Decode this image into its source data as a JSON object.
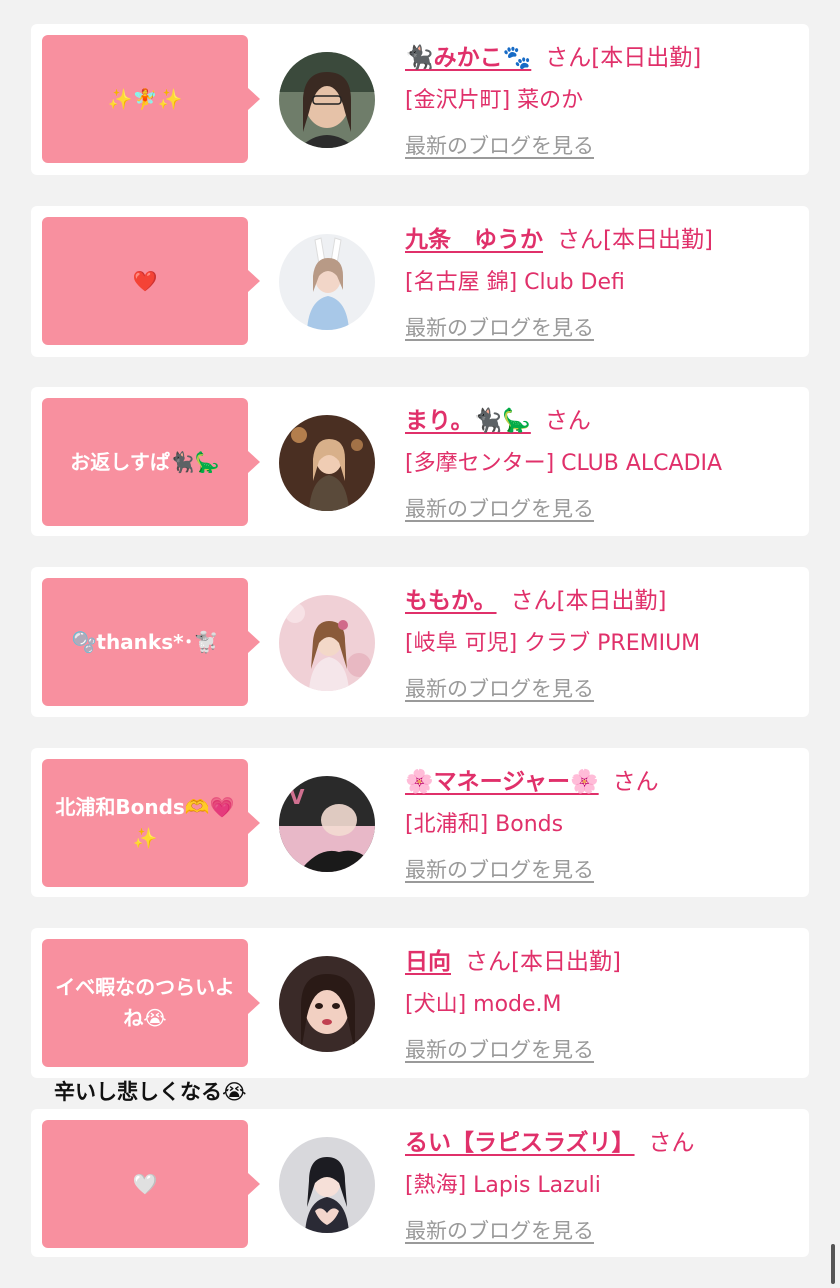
{
  "cards": [
    {
      "message": "✨🧚✨",
      "name": "🐈‍⬛みかこ🐾",
      "san": "さん",
      "shift": "[本日出勤]",
      "shop": "[金沢片町] 菜のか",
      "blog_link": "最新のブログを見る"
    },
    {
      "message": "❤️",
      "name": "九条　ゆうか",
      "san": "さん",
      "shift": "[本日出勤]",
      "shop": "[名古屋 錦] Club Defi",
      "blog_link": "最新のブログを見る"
    },
    {
      "message": "お返しすぱ🐈‍⬛🦕",
      "name": "まり。🐈‍⬛🦕",
      "san": "さん",
      "shift": "",
      "shop": "[多摩センター] CLUB ALCADIA",
      "blog_link": "最新のブログを見る"
    },
    {
      "message": "🫧thanks*･🐩",
      "name": "ももか。",
      "san": "さん",
      "shift": "[本日出勤]",
      "shop": "[岐阜 可児] クラブ PREMIUM",
      "blog_link": "最新のブログを見る"
    },
    {
      "message": "北浦和Bonds🫶💗✨",
      "name": "🌸マネージャー🌸",
      "san": "さん",
      "shift": "",
      "shop": "[北浦和] Bonds",
      "blog_link": "最新のブログを見る"
    },
    {
      "message": "イベ暇なのつらいよね😭",
      "name": "日向",
      "san": "さん",
      "shift": "[本日出勤]",
      "shop": "[犬山] mode.M",
      "blog_link": "最新のブログを見る"
    },
    {
      "message": "🤍",
      "name": "るい【ラピスラズリ】",
      "san": "さん",
      "shift": "",
      "shop": "[熱海] Lapis Lazuli",
      "blog_link": "最新のブログを見る"
    }
  ],
  "overflow_note": "辛いし悲しくなる😭",
  "colors": {
    "accent": "#e0306a",
    "bubble": "#f8909f",
    "link_gray": "#9a9a9a",
    "background": "#f2f2f2"
  }
}
